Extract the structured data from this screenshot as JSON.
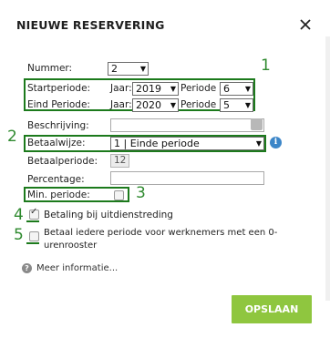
{
  "dialog": {
    "title": "NIEUWE RESERVERING",
    "close_icon": "close-icon"
  },
  "form": {
    "nummer_label": "Nummer:",
    "nummer_value": "2",
    "startperiode_label": "Startperiode:",
    "startperiode_jaar_label": "Jaar:",
    "startperiode_jaar_value": "2019",
    "startperiode_periode_label": "Periode :",
    "startperiode_periode_value": "6",
    "eindperiode_label": "Eind Periode:",
    "eindperiode_jaar_label": "Jaar:",
    "eindperiode_jaar_value": "2020",
    "eindperiode_periode_label": "Periode :",
    "eindperiode_periode_value": "5",
    "beschrijving_label": "Beschrijving:",
    "beschrijving_value": "",
    "betaalwijze_label": "Betaalwijze:",
    "betaalwijze_value": "1 | Einde periode",
    "betaalperiode_label": "Betaalperiode:",
    "betaalperiode_value": "12",
    "percentage_label": "Percentage:",
    "percentage_value": "",
    "min_periode_label": "Min. periode:",
    "min_periode_checked": false,
    "betaling_uitdienst_label": "Betaling bij uitdienstreding",
    "betaling_uitdienst_checked": true,
    "betaal_iedere_label_line1": "Betaal iedere periode voor werknemers met een 0-",
    "betaal_iedere_label_line2": "urenrooster",
    "betaal_iedere_checked": false
  },
  "annotations": {
    "n1": "1",
    "n2": "2",
    "n3": "3",
    "n4": "4",
    "n5": "5",
    "color": "#2f8a2f"
  },
  "footer": {
    "meer_info": "Meer informatie...",
    "save_label": "OPSLAAN",
    "save_color": "#8fc63f"
  }
}
